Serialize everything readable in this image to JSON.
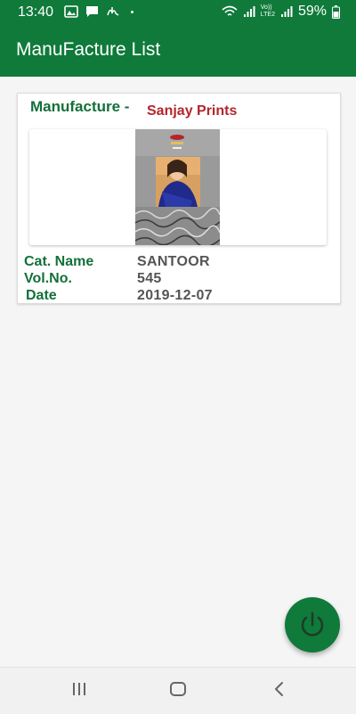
{
  "status_bar": {
    "time": "13:40",
    "battery_percent": "59%",
    "network_label_top": "Vo))",
    "network_label_bottom": "LTE2"
  },
  "app_bar": {
    "title": "ManuFacture List"
  },
  "card": {
    "manufacture_label": "Manufacture -",
    "manufacture_value": "Sanjay Prints",
    "catalog_name_label": "Cat. Name",
    "catalog_name_value": "SANTOOR",
    "volume_label": "Vol.No.",
    "volume_value": "545",
    "date_label": "Date",
    "date_value": "2019-12-07"
  },
  "fab": {
    "icon": "power-icon"
  },
  "nav_bar": {
    "recents_icon": "recents-icon",
    "home_icon": "home-icon",
    "back_icon": "back-icon"
  },
  "colors": {
    "primary": "#0f7a3a",
    "label_green": "#13703a",
    "accent_red": "#b3262b"
  }
}
